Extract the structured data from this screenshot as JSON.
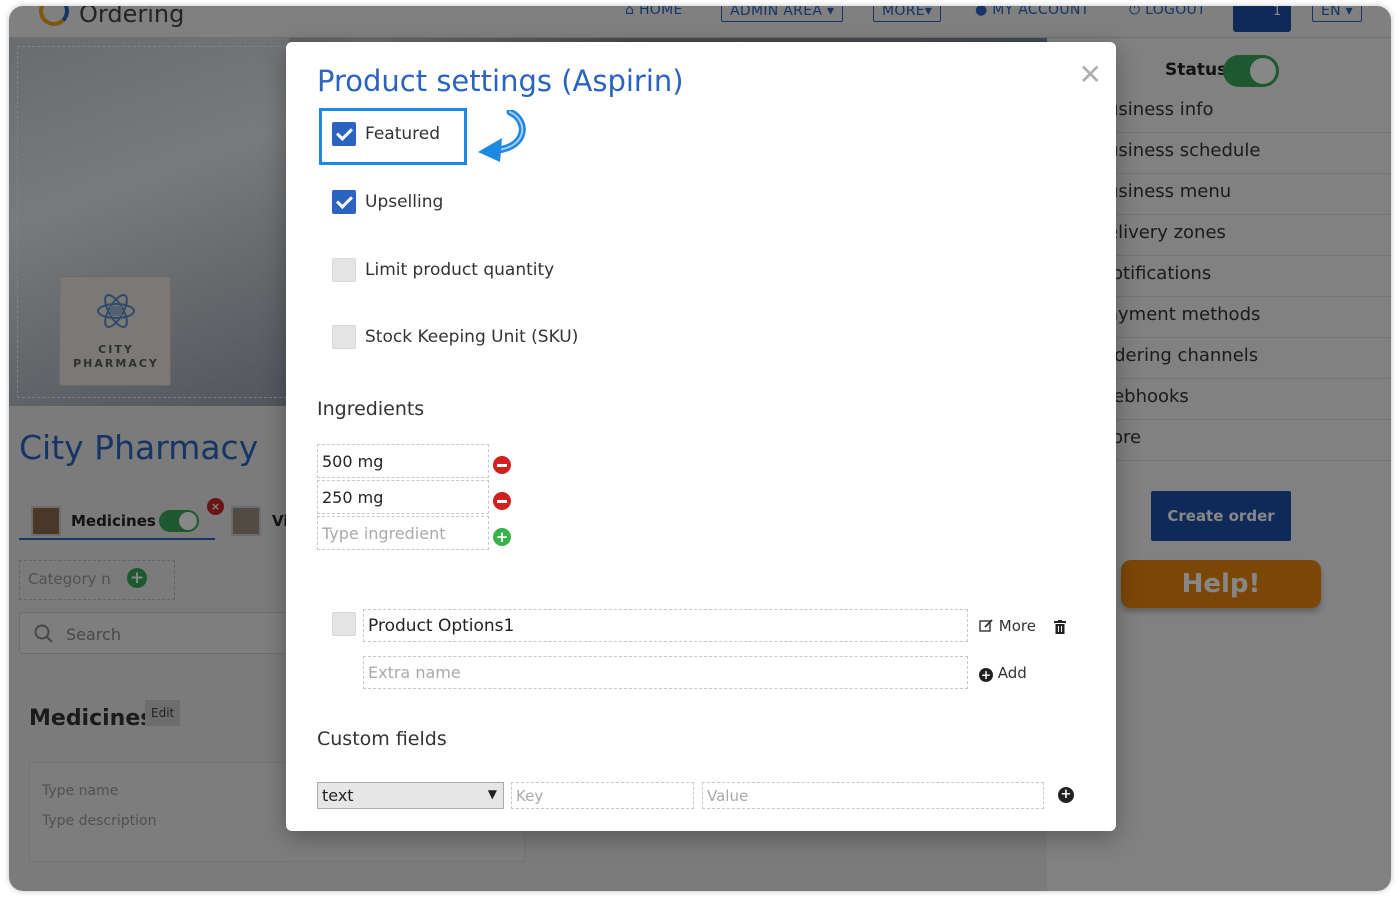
{
  "header": {
    "logo_text": "Ordering",
    "nav": {
      "home": "HOME",
      "admin_area": "ADMIN AREA",
      "more": "MORE",
      "my_account": "MY ACCOUNT",
      "logout": "LOGOUT",
      "language": "EN"
    },
    "cart_count": "1"
  },
  "store": {
    "logo_text_line1": "CITY",
    "logo_text_line2": "PHARMACY",
    "name": "City Pharmacy",
    "category_tab": "Medicines",
    "category_tab_2_partial": "Vi",
    "category_name_placeholder": "Category n",
    "search_placeholder": "Search",
    "section_title": "Medicines",
    "edit_label": "Edit",
    "new_product": {
      "name_placeholder": "Type name",
      "description_placeholder": "Type description"
    }
  },
  "sidebar": {
    "status_label": "Status",
    "menu_items": [
      "usiness info",
      "usiness schedule",
      "usiness menu",
      "elivery zones",
      "lotifications",
      "ayment methods",
      "rdering channels",
      "/ebhooks",
      "lore"
    ],
    "create_order": "Create order",
    "help": "Help!"
  },
  "modal": {
    "title": "Product settings (Aspirin)",
    "close_icon": "close-icon",
    "options": [
      {
        "label": "Featured",
        "checked": true
      },
      {
        "label": "Upselling",
        "checked": true
      },
      {
        "label": "Limit product quantity",
        "checked": false
      },
      {
        "label": "Stock Keeping Unit (SKU)",
        "checked": false
      }
    ],
    "ingredients_title": "Ingredients",
    "ingredients": [
      "500 mg",
      "250 mg"
    ],
    "ingredient_placeholder": "Type ingredient",
    "product_option": {
      "name": "Product Options1",
      "more_label": "More",
      "extra_placeholder": "Extra name",
      "add_label": "Add"
    },
    "custom_fields_title": "Custom fields",
    "custom_field": {
      "type_value": "text",
      "key_placeholder": "Key",
      "value_placeholder": "Value"
    },
    "highlight_color": "#1e88e5",
    "accent_color": "#2b64c0"
  }
}
